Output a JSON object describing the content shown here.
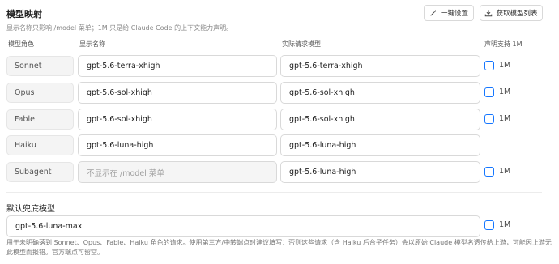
{
  "header": {
    "title": "模型映射",
    "subtitle": "显示名称只影响 /model 菜单；1M 只是给 Claude Code 的上下文能力声明。",
    "setup_button": "一键设置",
    "fetch_button": "获取模型列表"
  },
  "columns": {
    "role": "模型角色",
    "display": "显示名称",
    "actual": "实际请求模型",
    "declare": "声明支持 1M"
  },
  "rows": [
    {
      "role": "Sonnet",
      "display": "gpt-5.6-terra-xhigh",
      "actual": "gpt-5.6-terra-xhigh",
      "checkbox_label": "1M"
    },
    {
      "role": "Opus",
      "display": "gpt-5.6-sol-xhigh",
      "actual": "gpt-5.6-sol-xhigh",
      "checkbox_label": "1M"
    },
    {
      "role": "Fable",
      "display": "gpt-5.6-sol-xhigh",
      "actual": "gpt-5.6-sol-xhigh",
      "checkbox_label": "1M"
    },
    {
      "role": "Haiku",
      "display": "gpt-5.6-luna-high",
      "actual": "gpt-5.6-luna-high"
    },
    {
      "role": "Subagent",
      "display_placeholder": "不显示在 /model 菜单",
      "actual": "gpt-5.6-luna-high",
      "checkbox_label": "1M"
    }
  ],
  "fallback": {
    "title": "默认兜底模型",
    "value": "gpt-5.6-luna-max",
    "checkbox_label": "1M",
    "note": "用于未明确落到 Sonnet、Opus、Fable、Haiku 角色的请求。使用第三方/中转端点时建议填写：否则这些请求（含 Haiku 后台子任务）会以原始 Claude 模型名透传给上游，可能因上游无此模型而报错。官方端点可留空。"
  },
  "colors": {
    "accent": "#1677ff",
    "border": "#d9d9d9",
    "role_bg": "#f4f4f4"
  },
  "icons": {
    "setup": "magic-wand-icon",
    "fetch": "download-icon"
  }
}
